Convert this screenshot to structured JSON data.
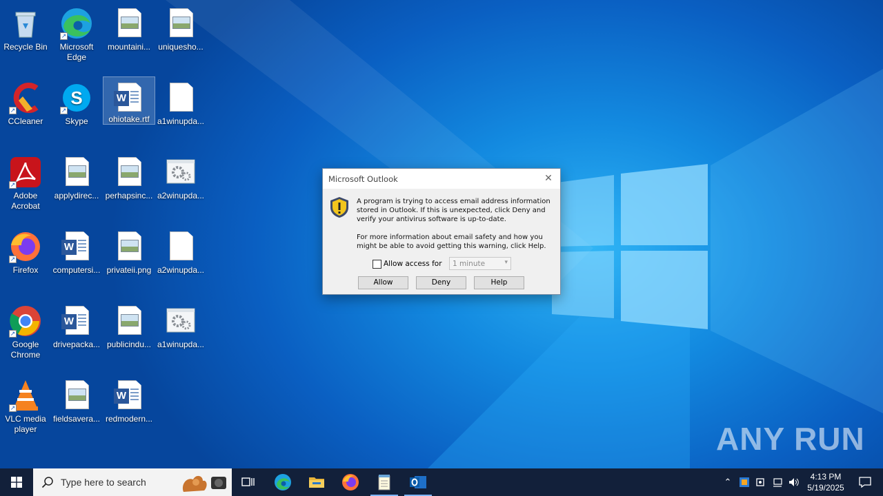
{
  "desktop": {
    "icons": [
      {
        "label": "Recycle Bin",
        "kind": "recycle-bin",
        "shortcut": false
      },
      {
        "label": "Microsoft Edge",
        "kind": "edge",
        "shortcut": true
      },
      {
        "label": "mountaini...",
        "kind": "image-file",
        "shortcut": false
      },
      {
        "label": "uniquesho...",
        "kind": "image-file",
        "shortcut": false
      },
      {
        "label": "CCleaner",
        "kind": "ccleaner",
        "shortcut": true
      },
      {
        "label": "Skype",
        "kind": "skype",
        "shortcut": true
      },
      {
        "label": "ohiotake.rtf",
        "kind": "word-file",
        "shortcut": false,
        "selected": true
      },
      {
        "label": "a1winupda...",
        "kind": "blank-file",
        "shortcut": false
      },
      {
        "label": "Adobe Acrobat",
        "kind": "acrobat",
        "shortcut": true
      },
      {
        "label": "applydirec...",
        "kind": "image-file",
        "shortcut": false
      },
      {
        "label": "perhapsinc...",
        "kind": "image-file",
        "shortcut": false
      },
      {
        "label": "a2winupda...",
        "kind": "gear-file",
        "shortcut": false
      },
      {
        "label": "Firefox",
        "kind": "firefox",
        "shortcut": true
      },
      {
        "label": "computersi...",
        "kind": "word-file",
        "shortcut": false
      },
      {
        "label": "privateii.png",
        "kind": "image-file",
        "shortcut": false
      },
      {
        "label": "a2winupda...",
        "kind": "blank-file",
        "shortcut": false
      },
      {
        "label": "Google Chrome",
        "kind": "chrome",
        "shortcut": true
      },
      {
        "label": "drivepacka...",
        "kind": "word-file",
        "shortcut": false
      },
      {
        "label": "publicindu...",
        "kind": "image-file",
        "shortcut": false
      },
      {
        "label": "a1winupda...",
        "kind": "gear-file",
        "shortcut": false
      },
      {
        "label": "VLC media player",
        "kind": "vlc",
        "shortcut": true
      },
      {
        "label": "fieldsavera...",
        "kind": "image-file",
        "shortcut": false
      },
      {
        "label": "redmodern...",
        "kind": "word-file",
        "shortcut": false
      }
    ]
  },
  "dialog": {
    "title": "Microsoft Outlook",
    "message_1": "A program is trying to access email address information stored in Outlook. If this is unexpected, click Deny and verify your antivirus software is up-to-date.",
    "message_2": "For more information about email safety and how you might be able to avoid getting this warning, click Help.",
    "allow_access_label": "Allow access for",
    "allow_access_checked": false,
    "duration_value": "1 minute",
    "buttons": {
      "allow": "Allow",
      "deny": "Deny",
      "help": "Help"
    }
  },
  "taskbar": {
    "search_placeholder": "Type here to search",
    "pinned": [
      "task-view",
      "edge",
      "file-explorer",
      "firefox",
      "notepad",
      "outlook"
    ],
    "active": [
      "notepad",
      "outlook"
    ],
    "clock_time": "4:13 PM",
    "clock_date": "5/19/2025"
  },
  "watermark": "ANY RUN",
  "colors": {
    "desktop_accent": "#138ae0",
    "taskbar": "#12203a",
    "dialog_bg": "#f0f0f0"
  }
}
